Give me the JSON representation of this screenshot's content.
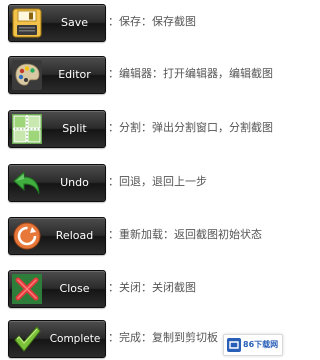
{
  "buttons": [
    {
      "id": "save",
      "icon": "floppy-disk-icon",
      "label": "Save",
      "description": "：保存：保存截图"
    },
    {
      "id": "editor",
      "icon": "palette-icon",
      "label": "Editor",
      "description": "：编辑器：打开编辑器，编辑截图"
    },
    {
      "id": "split",
      "icon": "split-grid-icon",
      "label": "Split",
      "description": "：分割：弹出分割窗口，分割截图"
    },
    {
      "id": "undo",
      "icon": "undo-arrow-icon",
      "label": "Undo",
      "description": "：回退，退回上一步"
    },
    {
      "id": "reload",
      "icon": "reload-icon",
      "label": "Reload",
      "description": "：重新加载：返回截图初始状态"
    },
    {
      "id": "close",
      "icon": "close-x-icon",
      "label": "Close",
      "description": "：关闭：关闭截图"
    },
    {
      "id": "complete",
      "icon": "checkmark-icon",
      "label": "Complete",
      "description": "：完成：复制到剪切板"
    }
  ],
  "watermark": {
    "text": "86下载网",
    "icon": "site-logo-icon"
  },
  "colors": {
    "button_dark": "#1c1c1c",
    "description_text": "#555555",
    "watermark_text": "#2a5fb8"
  }
}
